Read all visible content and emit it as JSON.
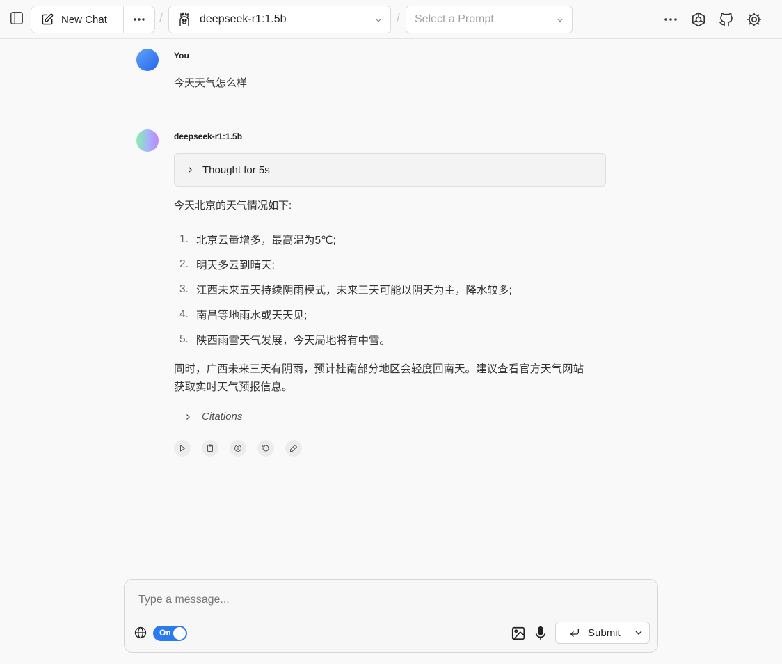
{
  "header": {
    "new_chat_label": "New Chat",
    "model_selected": "deepseek-r1:1.5b",
    "prompt_placeholder": "Select a Prompt",
    "separator": "/"
  },
  "conversation": {
    "user": {
      "name": "You",
      "text": "今天天气怎么样"
    },
    "assistant": {
      "name": "deepseek-r1:1.5b",
      "thought_label": "Thought for 5s",
      "intro": "今天北京的天气情况如下:",
      "items": [
        {
          "num": "1.",
          "text": "北京云量增多，最高温为5℃;"
        },
        {
          "num": "2.",
          "text": "明天多云到晴天;"
        },
        {
          "num": "3.",
          "text": "江西未来五天持续阴雨模式，未来三天可能以阴天为主，降水较多;"
        },
        {
          "num": "4.",
          "text": "南昌等地雨水或天天见;"
        },
        {
          "num": "5.",
          "text": "陕西雨雪天气发展，今天局地将有中雪。"
        }
      ],
      "paragraph": "同时，广西未来三天有阴雨，预计桂南部分地区会轻度回南天。建议查看官方天气网站获取实时天气预报信息。",
      "citations_label": "Citations"
    }
  },
  "composer": {
    "placeholder": "Type a message...",
    "web_search_toggle": "On",
    "submit_label": "Submit"
  },
  "colors": {
    "accent": "#2b7bef",
    "background": "#f9f9f9"
  }
}
